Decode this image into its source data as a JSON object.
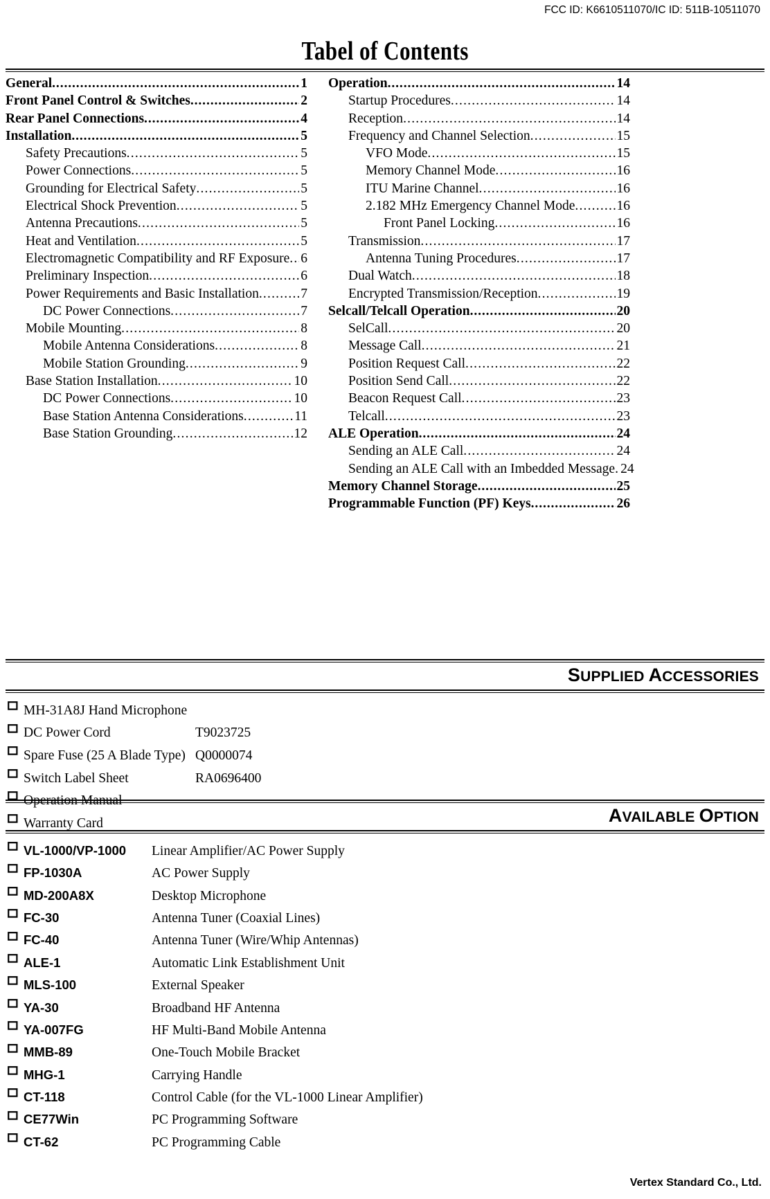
{
  "header": {
    "fcc_id": "FCC ID: K6610511070/IC ID: 511B-10511070"
  },
  "title": "Tabel of Contents",
  "toc": {
    "left_column": [
      {
        "level": 0,
        "label": "General",
        "page": "1"
      },
      {
        "level": 0,
        "label": "Front Panel Control & Switches",
        "page": "2"
      },
      {
        "level": 0,
        "label": "Rear Panel Connections",
        "page": "4"
      },
      {
        "level": 0,
        "label": "Installation",
        "page": "5"
      },
      {
        "level": 1,
        "label": "Safety Precautions",
        "page": "5"
      },
      {
        "level": 1,
        "label": "Power Connections",
        "page": "5"
      },
      {
        "level": 1,
        "label": "Grounding for Electrical Safety",
        "page": "5"
      },
      {
        "level": 1,
        "label": "Electrical Shock Prevention",
        "page": "5"
      },
      {
        "level": 1,
        "label": "Antenna Precautions",
        "page": "5"
      },
      {
        "level": 1,
        "label": "Heat and Ventilation",
        "page": "5"
      },
      {
        "level": 1,
        "label": "Electromagnetic Compatibility and RF Exposure",
        "page": "6"
      },
      {
        "level": 1,
        "label": "Preliminary Inspection",
        "page": "6"
      },
      {
        "level": 1,
        "label": "Power Requirements and Basic Installation",
        "page": "7"
      },
      {
        "level": 2,
        "label": "DC Power Connections",
        "page": "7"
      },
      {
        "level": 1,
        "label": "Mobile Mounting",
        "page": "8"
      },
      {
        "level": 2,
        "label": "Mobile Antenna Considerations",
        "page": "8"
      },
      {
        "level": 2,
        "label": "Mobile Station Grounding",
        "page": "9"
      },
      {
        "level": 1,
        "label": "Base Station Installation",
        "page": "10"
      },
      {
        "level": 2,
        "label": "DC Power Connections",
        "page": "10"
      },
      {
        "level": 2,
        "label": "Base Station Antenna Considerations",
        "page": "11"
      },
      {
        "level": 2,
        "label": "Base Station Grounding",
        "page": "12"
      }
    ],
    "right_column": [
      {
        "level": 0,
        "label": "Operation",
        "page": "14"
      },
      {
        "level": 1,
        "label": "Startup Procedures",
        "page": "14"
      },
      {
        "level": 1,
        "label": "Reception",
        "page": "14"
      },
      {
        "level": 1,
        "label": "Frequency and Channel Selection",
        "page": "15"
      },
      {
        "level": 2,
        "label": "VFO Mode",
        "page": "15"
      },
      {
        "level": 2,
        "label": "Memory Channel Mode",
        "page": "16"
      },
      {
        "level": 2,
        "label": "ITU Marine Channel",
        "page": "16"
      },
      {
        "level": 2,
        "label": "2.182 MHz Emergency Channel Mode",
        "page": "16"
      },
      {
        "level": 3,
        "label": "Front Panel Locking",
        "page": "16"
      },
      {
        "level": 1,
        "label": "Transmission",
        "page": "17"
      },
      {
        "level": 2,
        "label": "Antenna Tuning Procedures",
        "page": "17"
      },
      {
        "level": 1,
        "label": "Dual Watch",
        "page": "18"
      },
      {
        "level": 1,
        "label": "Encrypted Transmission/Reception",
        "page": "19"
      },
      {
        "level": 0,
        "label": "Selcall/Telcall Operation",
        "page": "20"
      },
      {
        "level": 1,
        "label": "SelCall",
        "page": "20"
      },
      {
        "level": 1,
        "label": "Message Call",
        "page": "21"
      },
      {
        "level": 1,
        "label": "Position Request Call",
        "page": "22"
      },
      {
        "level": 1,
        "label": "Position Send Call",
        "page": "22"
      },
      {
        "level": 1,
        "label": "Beacon Request Call",
        "page": "23"
      },
      {
        "level": 1,
        "label": "Telcall",
        "page": "23"
      },
      {
        "level": 0,
        "label": "ALE Operation",
        "page": "24"
      },
      {
        "level": 1,
        "label": "Sending an ALE Call",
        "page": "24"
      },
      {
        "level": 1,
        "label": "Sending an ALE Call with an Imbedded Message",
        "page": "24"
      },
      {
        "level": 0,
        "label": "Memory Channel Storage",
        "page": "25"
      },
      {
        "level": 0,
        "label": "Programmable Function (PF) Keys",
        "page": "26"
      }
    ]
  },
  "supplied_accessories": {
    "heading_small_caps_first": "S",
    "heading_rest_1": "UPPLIED ",
    "heading_small_caps_second": "A",
    "heading_rest_2": "CCESSORIES",
    "heading_full": "SUPPLIED ACCESSORIES",
    "items": [
      {
        "name": "MH-31A8J Hand Microphone",
        "code": ""
      },
      {
        "name": "DC Power Cord",
        "code": "T9023725"
      },
      {
        "name": "Spare Fuse (25 A Blade Type)",
        "code": "Q0000074"
      },
      {
        "name": "Switch Label Sheet",
        "code": "RA0696400"
      },
      {
        "name": "Operation Manual",
        "code": ""
      },
      {
        "name": "Warranty Card",
        "code": ""
      }
    ]
  },
  "available_option": {
    "heading_small_caps_first": "A",
    "heading_rest_1": "VAILABLE ",
    "heading_small_caps_second": "O",
    "heading_rest_2": "PTION",
    "heading_full": "AVAILABLE OPTION",
    "items": [
      {
        "name": "VL-1000/VP-1000",
        "desc": "Linear Amplifier/AC Power Supply"
      },
      {
        "name": "FP-1030A",
        "desc": "AC Power Supply"
      },
      {
        "name": "MD-200A8X",
        "desc": "Desktop Microphone"
      },
      {
        "name": "FC-30",
        "desc": "Antenna Tuner (Coaxial Lines)"
      },
      {
        "name": "FC-40",
        "desc": "Antenna Tuner (Wire/Whip Antennas)"
      },
      {
        "name": "ALE-1",
        "desc": "Automatic Link Establishment Unit"
      },
      {
        "name": "MLS-100",
        "desc": "External Speaker"
      },
      {
        "name": "YA-30",
        "desc": "Broadband HF Antenna"
      },
      {
        "name": "YA-007FG",
        "desc": "HF Multi-Band Mobile Antenna"
      },
      {
        "name": "MMB-89",
        "desc": "One-Touch Mobile Bracket"
      },
      {
        "name": "MHG-1",
        "desc": "Carrying Handle"
      },
      {
        "name": "CT-118",
        "desc": "Control Cable (for the VL-1000 Linear Amplifier)"
      },
      {
        "name": "CE77Win",
        "desc": "PC Programming Software"
      },
      {
        "name": "CT-62",
        "desc": "PC Programming Cable"
      }
    ]
  },
  "footer": {
    "company": "Vertex Standard Co., Ltd."
  }
}
